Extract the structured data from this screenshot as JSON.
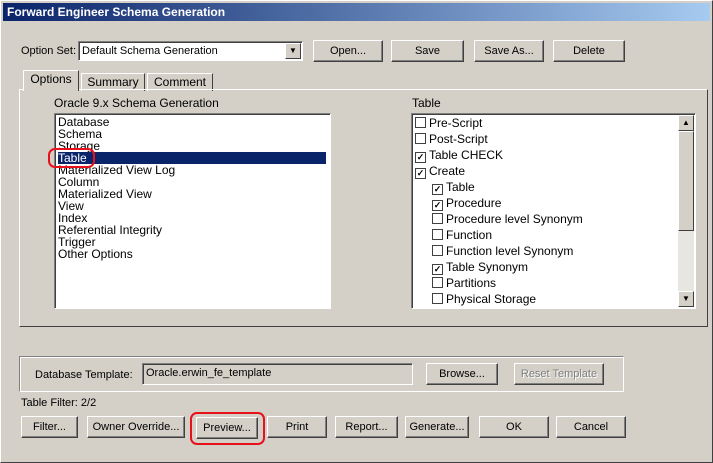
{
  "window": {
    "title": "Forward Engineer Schema Generation"
  },
  "option_set": {
    "label": "Option Set:",
    "value": "Default Schema Generation",
    "buttons": {
      "open": "Open...",
      "save": "Save",
      "save_as": "Save As...",
      "delete": "Delete"
    }
  },
  "tabs": [
    "Options",
    "Summary",
    "Comment"
  ],
  "left_group": {
    "title": "Oracle 9.x Schema Generation",
    "items": [
      "Database",
      "Schema",
      "Storage",
      "Table",
      "Materialized View Log",
      "Column",
      "Materialized View",
      "View",
      "Index",
      "Referential Integrity",
      "Trigger",
      "Other Options"
    ],
    "selected": "Table"
  },
  "right_group": {
    "title": "Table",
    "items": [
      {
        "label": "Pre-Script",
        "checked": false,
        "indent": 0
      },
      {
        "label": "Post-Script",
        "checked": false,
        "indent": 0
      },
      {
        "label": "Table CHECK",
        "checked": true,
        "indent": 0
      },
      {
        "label": "Create",
        "checked": true,
        "indent": 0
      },
      {
        "label": "Table",
        "checked": true,
        "indent": 1
      },
      {
        "label": "Procedure",
        "checked": true,
        "indent": 1
      },
      {
        "label": "Procedure level Synonym",
        "checked": false,
        "indent": 1
      },
      {
        "label": "Function",
        "checked": false,
        "indent": 1
      },
      {
        "label": "Function level Synonym",
        "checked": false,
        "indent": 1
      },
      {
        "label": "Table Synonym",
        "checked": true,
        "indent": 1
      },
      {
        "label": "Partitions",
        "checked": false,
        "indent": 1
      },
      {
        "label": "Physical Storage",
        "checked": false,
        "indent": 1
      }
    ]
  },
  "database_template": {
    "label": "Database Template:",
    "value": "Oracle.erwin_fe_template",
    "browse": "Browse...",
    "reset": "Reset Template"
  },
  "table_filter": "Table Filter: 2/2",
  "bottom_buttons": {
    "filter": "Filter...",
    "owner_override": "Owner Override...",
    "preview": "Preview...",
    "print": "Print",
    "report": "Report...",
    "generate": "Generate...",
    "ok": "OK",
    "cancel": "Cancel"
  },
  "colors": {
    "highlight_ring": "#e8111b",
    "selection": "#0a246a",
    "titlebar": "#0a246a"
  }
}
